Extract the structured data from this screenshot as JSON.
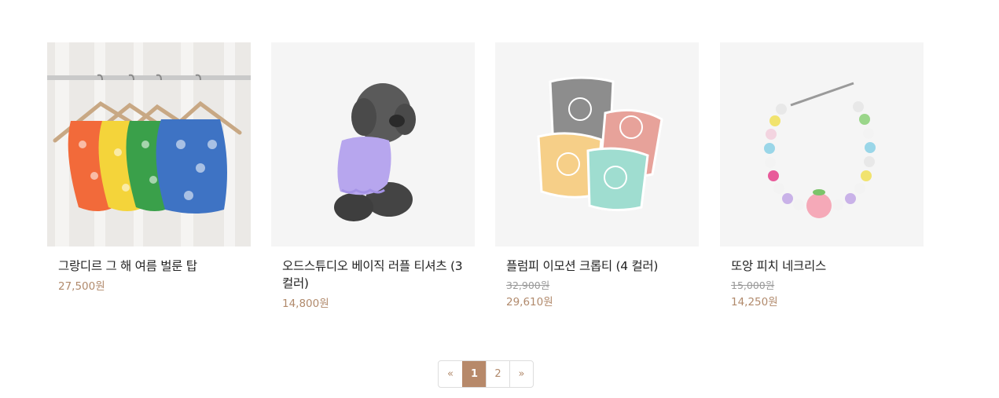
{
  "products": [
    {
      "name": "그랑디르 그 해 여름 벌룬 탑",
      "original_price": "",
      "price": "27,500원",
      "image": "hanging-balloon-tops-image"
    },
    {
      "name": "오드스튜디오 베이직 러플 티셔츠 (3컬러)",
      "original_price": "",
      "price": "14,800원",
      "image": "poodle-purple-ruffle-tee-image"
    },
    {
      "name": "플럼피 이모션 크롭티 (4 컬러)",
      "original_price": "32,900원",
      "price": "29,610원",
      "image": "smiley-crop-tees-image"
    },
    {
      "name": "또앙 피치 네크리스",
      "original_price": "15,000원",
      "price": "14,250원",
      "image": "peach-bead-necklace-image"
    }
  ],
  "pagination": {
    "prev": "«",
    "pages": [
      "1",
      "2"
    ],
    "current": "1",
    "next": "»"
  },
  "colors": {
    "accent": "#b7896a",
    "price_text": "#b18a6c",
    "thumb_bg": "#f5f5f5"
  }
}
